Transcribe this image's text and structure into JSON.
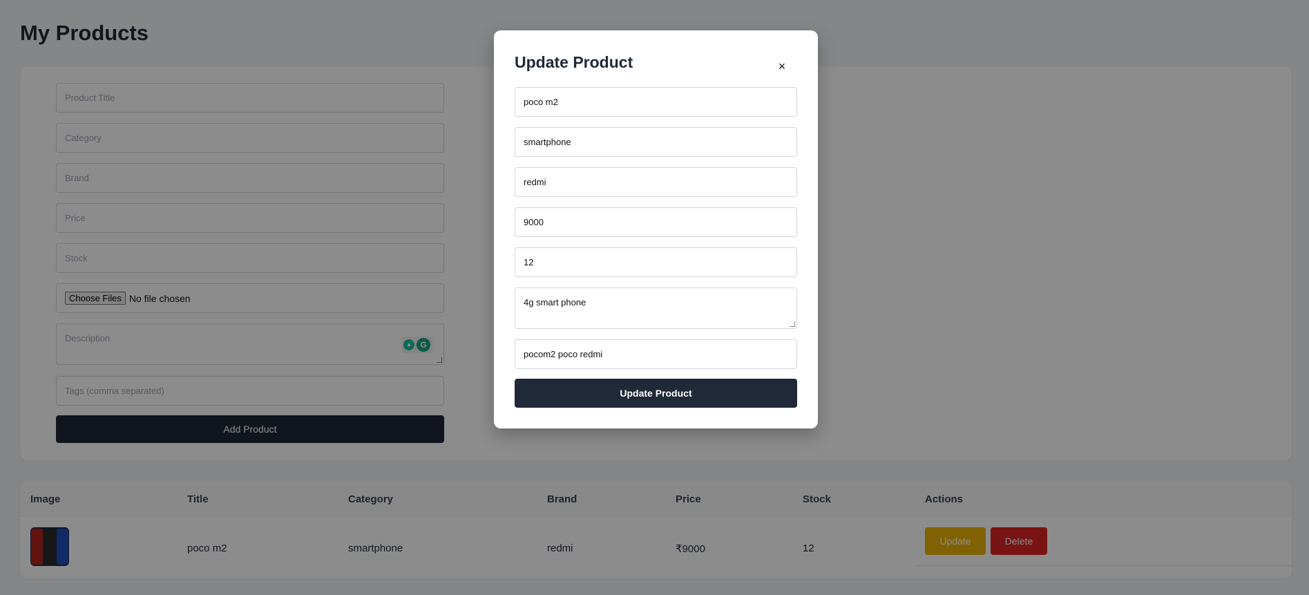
{
  "page": {
    "title": "My Products"
  },
  "add_form": {
    "title_placeholder": "Product Title",
    "category_placeholder": "Category",
    "brand_placeholder": "Brand",
    "price_placeholder": "Price",
    "stock_placeholder": "Stock",
    "file_button": "Choose Files",
    "file_status": "No file chosen",
    "description_placeholder": "Description",
    "tags_placeholder": "Tags (comma separated)",
    "submit_label": "Add Product"
  },
  "table": {
    "headers": [
      "Image",
      "Title",
      "Category",
      "Brand",
      "Price",
      "Stock",
      "Actions"
    ],
    "rows": [
      {
        "title": "poco m2",
        "category": "smartphone",
        "brand": "redmi",
        "price": "₹9000",
        "stock": "12",
        "update_label": "Update",
        "delete_label": "Delete"
      }
    ]
  },
  "modal": {
    "title": "Update Product",
    "close_icon": "×",
    "title_value": "poco m2",
    "category_value": "smartphone",
    "brand_value": "redmi",
    "price_value": "9000",
    "stock_value": "12",
    "description_value": "4g smart phone",
    "tags_value": "pocom2 poco redmi",
    "submit_label": "Update Product"
  },
  "colors": {
    "primary_dark": "#1f2937",
    "update_yellow": "#eab308",
    "delete_red": "#dc2626",
    "grammarly_green": "#15c39a"
  },
  "icons": {
    "grammarly_bulb": "bulb-icon",
    "grammarly_logo": "grammarly-icon",
    "close": "close-icon"
  }
}
